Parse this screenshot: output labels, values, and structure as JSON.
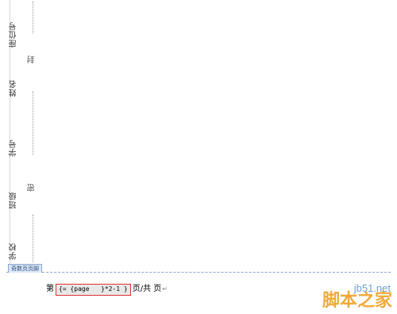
{
  "binding_margin": {
    "fields": [
      {
        "label": "座位号"
      },
      {
        "label": "姓名"
      },
      {
        "label": "学号"
      },
      {
        "label": "班级"
      },
      {
        "label": "学校"
      }
    ],
    "seal_chars": [
      "封",
      "密"
    ]
  },
  "footer": {
    "tab_label": "奇数页页脚",
    "prefix": "第",
    "field_code": "{= {page   }*2-1 }",
    "suffix": "页/共 页",
    "paragraph_mark": "↵"
  },
  "watermark": {
    "site": "jb51.net",
    "brand": "脚本之家"
  }
}
